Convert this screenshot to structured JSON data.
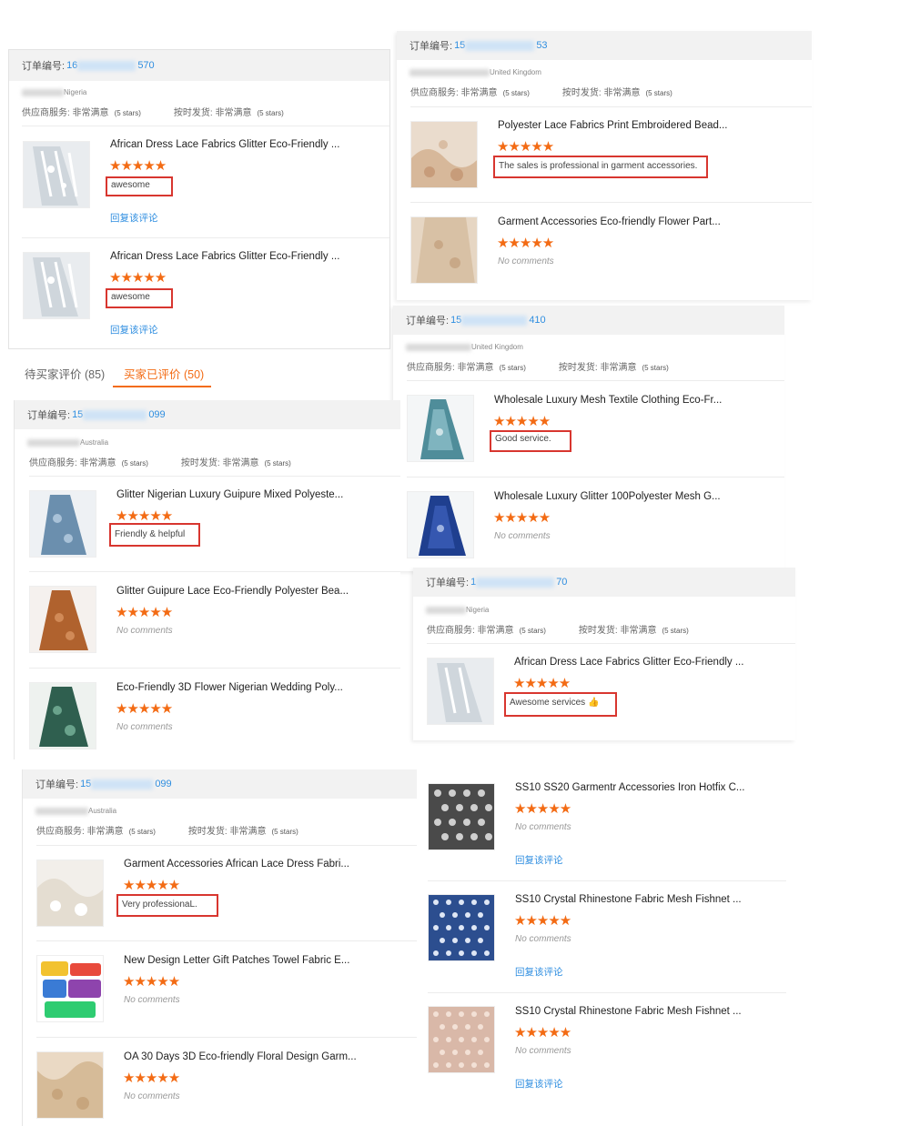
{
  "colors": {
    "accent": "#f36b14",
    "link": "#2f8ee0",
    "highlight_border": "#d8362f",
    "header_bg": "#f2f2f2"
  },
  "tabs": [
    {
      "label": "待买家评价 (85)",
      "active": false
    },
    {
      "label": "买家已评价 (50)",
      "active": true
    }
  ],
  "labels": {
    "order_no": "订单编号:",
    "supplier_service": "供应商服务: 非常满意",
    "ship_on_time": "按时发货: 非常满意",
    "five_stars": "(5 stars)",
    "no_comments": "No comments",
    "reply": "回复该评论",
    "stars": "★★★★★"
  },
  "cards": {
    "c1": {
      "order_prefix": "16",
      "order_suffix": "570",
      "country": "Nigeria",
      "items": [
        {
          "title": "African Dress Lace Fabrics Glitter Eco-Friendly ...",
          "review": "awesome",
          "icon": "lace-fabric-thumbnail"
        },
        {
          "title": "African Dress Lace Fabrics Glitter Eco-Friendly ...",
          "review": "awesome",
          "icon": "lace-fabric-thumbnail"
        }
      ]
    },
    "c2": {
      "order_prefix": "15",
      "order_suffix": "53",
      "country": "United Kingdom",
      "items": [
        {
          "title": "Polyester Lace Fabrics Print Embroidered Bead...",
          "review": "The sales is professional in garment accessories."
        },
        {
          "title": "Garment Accessories Eco-friendly Flower Part...",
          "review": ""
        }
      ]
    },
    "c3": {
      "order_prefix": "15",
      "order_suffix": "410",
      "country": "United Kingdom",
      "items": [
        {
          "title": "Wholesale Luxury Mesh Textile Clothing Eco-Fr...",
          "review": "Good service."
        },
        {
          "title": "Wholesale Luxury Glitter 100Polyester Mesh G...",
          "review": ""
        }
      ]
    },
    "c4": {
      "order_prefix": "15",
      "order_suffix": "099",
      "country": "Australia",
      "items": [
        {
          "title": "Glitter Nigerian Luxury Guipure Mixed Polyeste...",
          "review": "Friendly & helpful"
        },
        {
          "title": "Glitter Guipure Lace Eco-Friendly Polyester Bea...",
          "review": ""
        },
        {
          "title": "Eco-Friendly 3D Flower Nigerian Wedding Poly...",
          "review": ""
        }
      ]
    },
    "c5": {
      "order_prefix": "1",
      "order_suffix": "70",
      "country": "Nigeria",
      "items": [
        {
          "title": "African Dress Lace Fabrics Glitter Eco-Friendly ...",
          "review": "Awesome services 👍"
        }
      ]
    },
    "c6": {
      "order_prefix": "15",
      "order_suffix": "099",
      "country": "Australia",
      "items": [
        {
          "title": "Garment Accessories African Lace Dress Fabri...",
          "review": "Very professionaL."
        },
        {
          "title": "New Design Letter Gift Patches Towel Fabric E...",
          "review": ""
        },
        {
          "title": "OA 30 Days 3D Eco-friendly Floral Design Garm...",
          "review": ""
        }
      ]
    },
    "c7": {
      "items": [
        {
          "title": "SS10 SS20 Garmentr Accessories Iron Hotfix C..."
        },
        {
          "title": "SS10 Crystal Rhinestone Fabric Mesh Fishnet ..."
        },
        {
          "title": "SS10 Crystal Rhinestone Fabric Mesh Fishnet ..."
        }
      ]
    }
  }
}
